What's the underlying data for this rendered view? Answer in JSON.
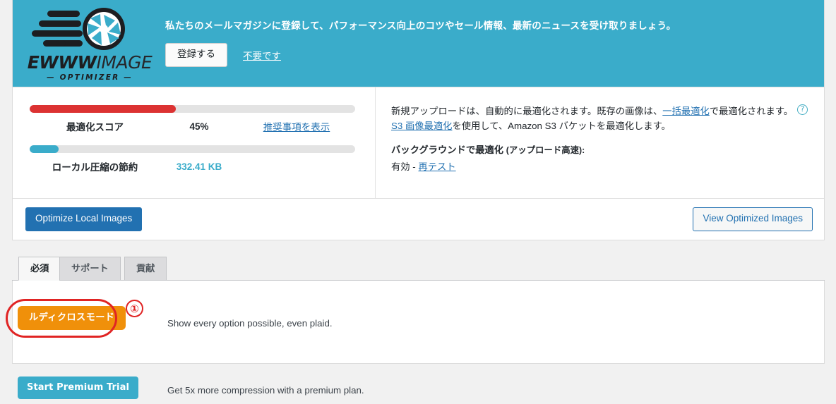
{
  "banner": {
    "logo": {
      "icon": "camera-aperture-speed-icon",
      "word_bold": "EWWW",
      "word_thin": "IMAGE",
      "subtitle": "— OPTIMIZER —"
    },
    "message": "私たちのメールマガジンに登録して、パフォーマンス向上のコツやセール情報、最新のニュースを受け取りましょう。",
    "subscribe_label": "登録する",
    "dismiss_label": "不要です",
    "background_color": "#3aacca"
  },
  "stats": {
    "bars": [
      {
        "label": "最適化スコア",
        "value": "45%",
        "action": "推奨事項を表示",
        "percent": 45,
        "color": "#dc3232",
        "value_color": "#23282d"
      },
      {
        "label": "ローカル圧縮の節約",
        "value": "332.41 KB",
        "action": "",
        "percent": 9,
        "color": "#3aacca",
        "value_color": "#3aacca"
      }
    ]
  },
  "info": {
    "line1_part1": "新規アップロードは、自動的に最適化されます。既存の画像は、",
    "line1_link": "一括最適化",
    "line1_part2": "で最適化されます。",
    "help_icon": "question-mark-circle-icon",
    "line2_link": "S3 画像最適化",
    "line2_part2": "を使用して、Amazon S3 バケットを最適化します。",
    "background_heading": "バックグラウンドで最適化",
    "background_heading_note": "(アップロード高速):",
    "background_status": "有効 - ",
    "background_retest_link": "再テスト"
  },
  "actions": {
    "optimize_label": "Optimize Local Images",
    "view_label": "View Optimized Images",
    "primary_color": "#2271b1"
  },
  "tabs": [
    {
      "label": "必須",
      "active": true
    },
    {
      "label": "サポート",
      "active": false
    },
    {
      "label": "貢献",
      "active": false
    }
  ],
  "options": {
    "ludicrous": {
      "button_label": "ルディクロスモード",
      "description": "Show every option possible, even plaid.",
      "color": "#f0900a",
      "annotation_number": "①",
      "annotation_color": "#e02424"
    },
    "premium": {
      "button_label": "Start Premium Trial",
      "description": "Get 5x more compression with a premium plan.",
      "color": "#3aacca"
    }
  }
}
